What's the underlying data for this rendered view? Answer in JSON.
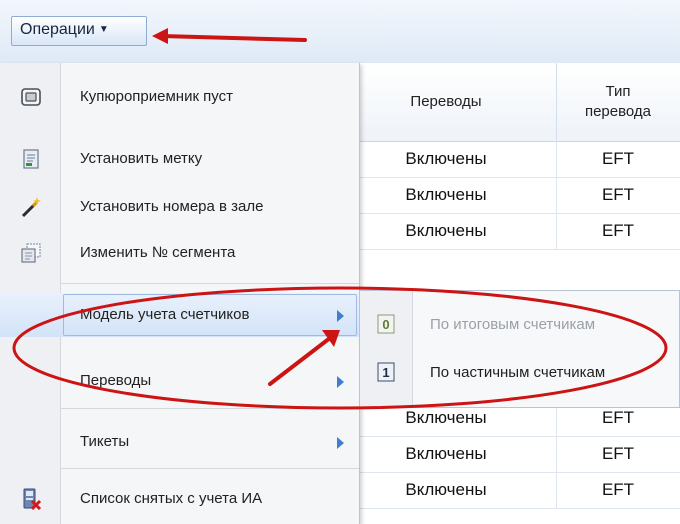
{
  "toolbar": {
    "operations_label": "Операции"
  },
  "table": {
    "headers": [
      "Переводы",
      "Тип перевода"
    ],
    "rows": [
      [
        "Включены",
        "EFT"
      ],
      [
        "Включены",
        "EFT"
      ],
      [
        "Включены",
        "EFT"
      ],
      [
        "Включены",
        "EFT"
      ],
      [
        "Включены",
        "EFT"
      ],
      [
        "Включены",
        "EFT"
      ]
    ]
  },
  "menu": {
    "items": [
      {
        "label": "Купюроприемник пуст",
        "icon": "bill-acceptor-icon"
      },
      {
        "label": "Установить метку",
        "icon": "label-icon"
      },
      {
        "label": "Установить номера в зале",
        "icon": "magic-wand-icon"
      },
      {
        "label": "Изменить № сегмента",
        "icon": "segment-icon"
      },
      {
        "label": "Модель учета счетчиков",
        "icon": ""
      },
      {
        "label": "Переводы",
        "icon": ""
      },
      {
        "label": "Тикеты",
        "icon": ""
      },
      {
        "label": "Список снятых с учета ИА",
        "icon": "removed-device-icon"
      }
    ]
  },
  "submenu": {
    "items": [
      {
        "label": "По итоговым счетчикам",
        "icon": "total-counter-icon",
        "disabled": true
      },
      {
        "label": "По частичным счетчикам",
        "icon": "partial-counter-icon",
        "disabled": false
      }
    ]
  },
  "colors": {
    "accent": "#3c7fd1",
    "annotation": "#cc1414"
  }
}
